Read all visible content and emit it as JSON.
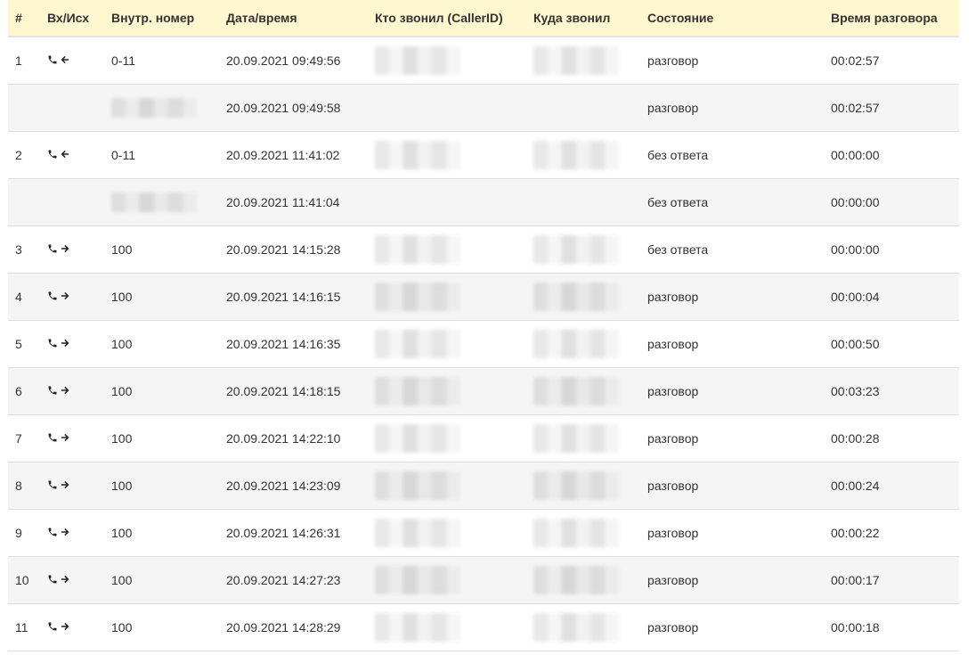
{
  "table": {
    "headers": {
      "num": "#",
      "direction": "Вх/Исх",
      "extension": "Внутр. номер",
      "datetime": "Дата/время",
      "caller": "Кто звонил (CallerID)",
      "callee": "Куда звонил",
      "status": "Состояние",
      "duration": "Время разговора"
    },
    "rows": [
      {
        "num": "1",
        "direction": "incoming",
        "extension": "0-11",
        "datetime": "20.09.2021 09:49:56",
        "status": "разговор",
        "duration": "00:02:57"
      },
      {
        "num": "",
        "direction": "",
        "extension": "",
        "datetime": "20.09.2021 09:49:58",
        "status": "разговор",
        "duration": "00:02:57"
      },
      {
        "num": "2",
        "direction": "incoming",
        "extension": "0-11",
        "datetime": "20.09.2021 11:41:02",
        "status": "без ответа",
        "duration": "00:00:00"
      },
      {
        "num": "",
        "direction": "",
        "extension": "",
        "datetime": "20.09.2021 11:41:04",
        "status": "без ответа",
        "duration": "00:00:00"
      },
      {
        "num": "3",
        "direction": "outgoing",
        "extension": "100",
        "datetime": "20.09.2021 14:15:28",
        "status": "без ответа",
        "duration": "00:00:00"
      },
      {
        "num": "4",
        "direction": "outgoing",
        "extension": "100",
        "datetime": "20.09.2021 14:16:15",
        "status": "разговор",
        "duration": "00:00:04"
      },
      {
        "num": "5",
        "direction": "outgoing",
        "extension": "100",
        "datetime": "20.09.2021 14:16:35",
        "status": "разговор",
        "duration": "00:00:50"
      },
      {
        "num": "6",
        "direction": "outgoing",
        "extension": "100",
        "datetime": "20.09.2021 14:18:15",
        "status": "разговор",
        "duration": "00:03:23"
      },
      {
        "num": "7",
        "direction": "outgoing",
        "extension": "100",
        "datetime": "20.09.2021 14:22:10",
        "status": "разговор",
        "duration": "00:00:28"
      },
      {
        "num": "8",
        "direction": "outgoing",
        "extension": "100",
        "datetime": "20.09.2021 14:23:09",
        "status": "разговор",
        "duration": "00:00:24"
      },
      {
        "num": "9",
        "direction": "outgoing",
        "extension": "100",
        "datetime": "20.09.2021 14:26:31",
        "status": "разговор",
        "duration": "00:00:22"
      },
      {
        "num": "10",
        "direction": "outgoing",
        "extension": "100",
        "datetime": "20.09.2021 14:27:23",
        "status": "разговор",
        "duration": "00:00:17"
      },
      {
        "num": "11",
        "direction": "outgoing",
        "extension": "100",
        "datetime": "20.09.2021 14:28:29",
        "status": "разговор",
        "duration": "00:00:18"
      }
    ]
  },
  "colors": {
    "header_bg": "#fff7cf",
    "stripe_bg": "#f5f5f5",
    "text": "#333333"
  }
}
